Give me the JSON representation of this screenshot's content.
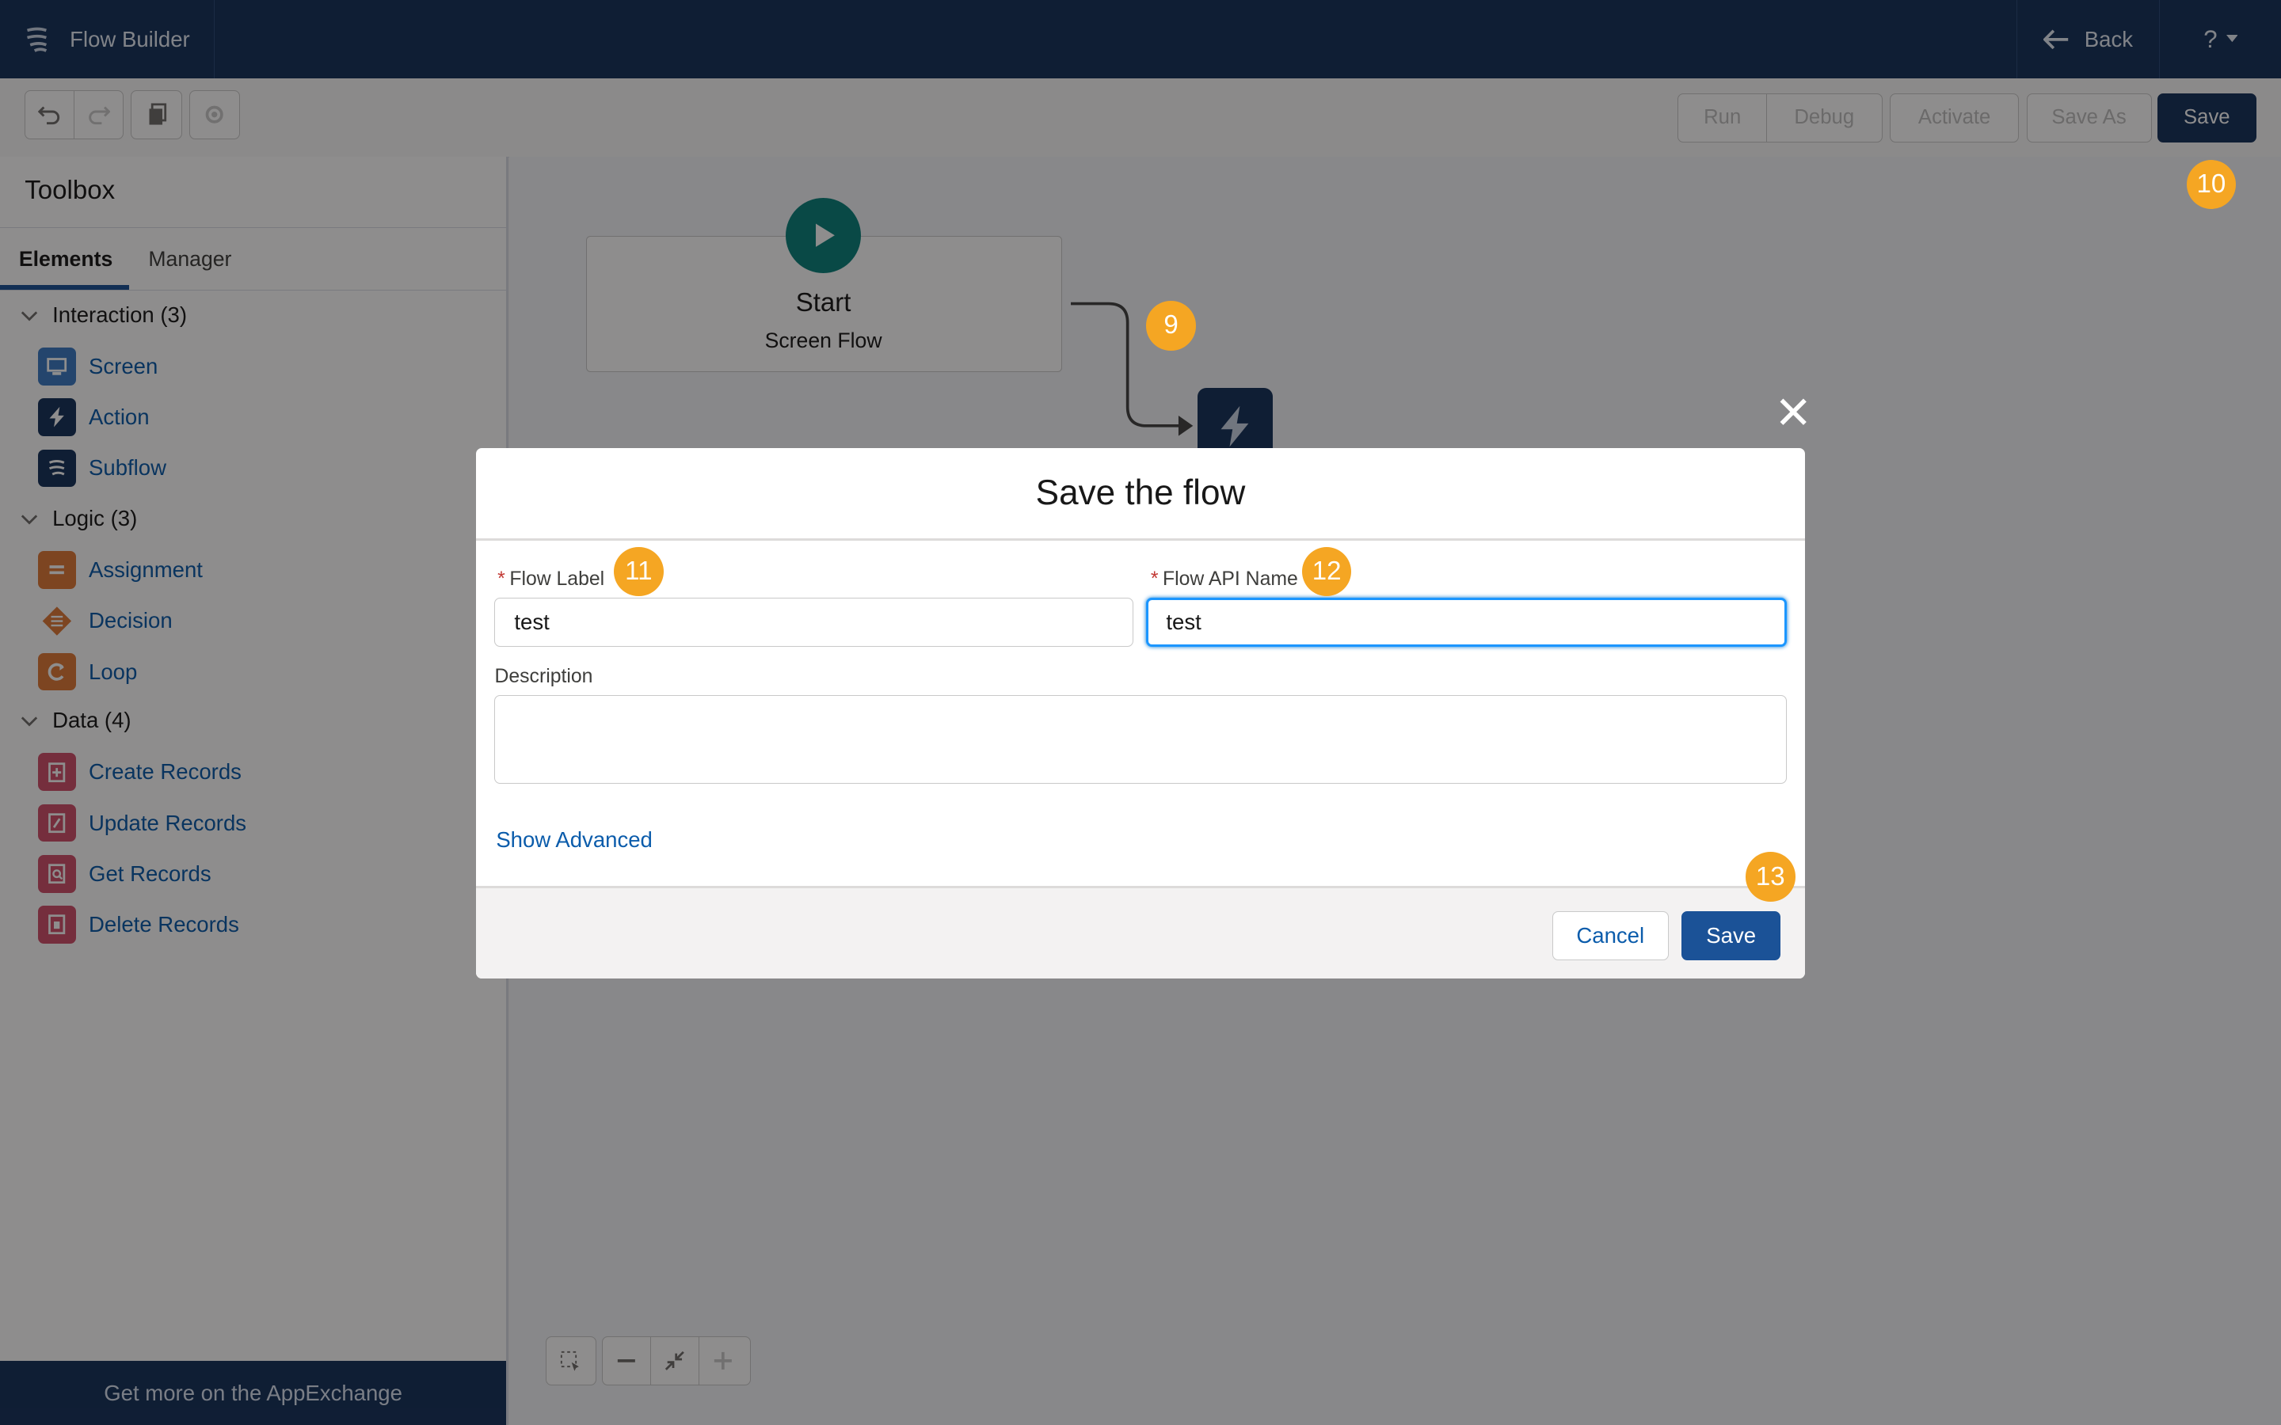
{
  "app": {
    "title": "Flow Builder",
    "back_label": "Back",
    "help_label": "?"
  },
  "toolbar": {
    "run": "Run",
    "debug": "Debug",
    "activate": "Activate",
    "save_as": "Save As",
    "save": "Save"
  },
  "toolbox": {
    "title": "Toolbox",
    "tabs": [
      "Elements",
      "Manager"
    ],
    "sections": [
      {
        "label": "Interaction (3)",
        "items": [
          "Screen",
          "Action",
          "Subflow"
        ]
      },
      {
        "label": "Logic (3)",
        "items": [
          "Assignment",
          "Decision",
          "Loop"
        ]
      },
      {
        "label": "Data (4)",
        "items": [
          "Create Records",
          "Update Records",
          "Get Records",
          "Delete Records"
        ]
      }
    ],
    "footer": "Get more on the AppExchange"
  },
  "canvas": {
    "start_title": "Start",
    "start_subtitle": "Screen Flow"
  },
  "modal": {
    "title": "Save the flow",
    "flow_label": {
      "label": "Flow Label",
      "value": "test"
    },
    "flow_api_name": {
      "label": "Flow API Name",
      "value": "test"
    },
    "description": {
      "label": "Description",
      "value": ""
    },
    "show_advanced": "Show Advanced",
    "cancel": "Cancel",
    "save": "Save"
  },
  "badges": [
    "9",
    "10",
    "11",
    "12",
    "13"
  ],
  "colors": {
    "header": "#16325c",
    "accent": "#1b5297",
    "badge": "#f5a623",
    "screen_icon": "#3b7ac5",
    "action_icon": "#16325c",
    "logic_icon": "#e07b39",
    "data_icon": "#d1516b"
  }
}
